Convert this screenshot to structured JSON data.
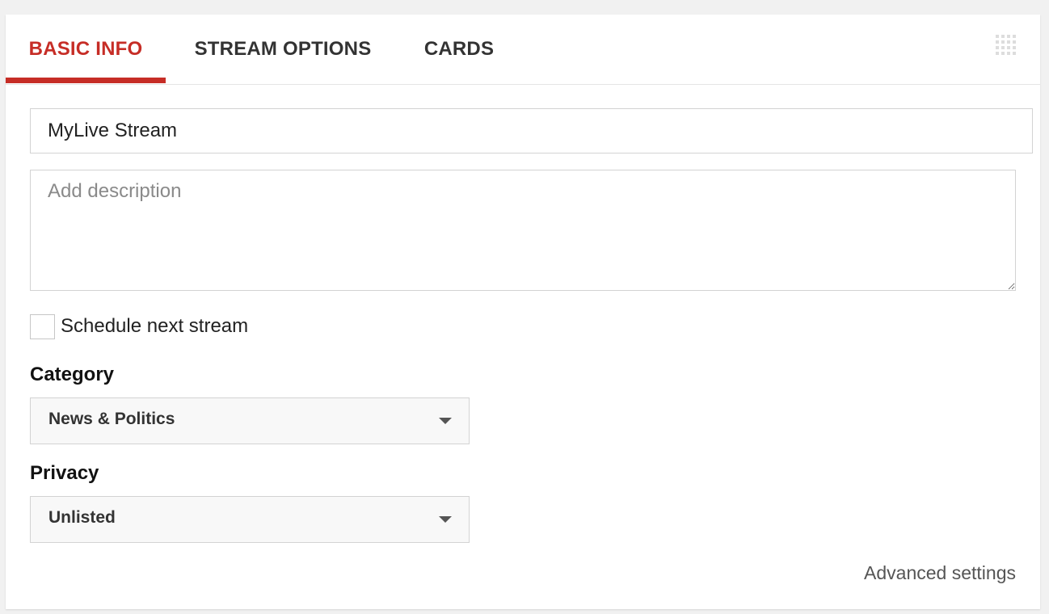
{
  "tabs": [
    {
      "label": "BASIC INFO",
      "active": true
    },
    {
      "label": "STREAM OPTIONS",
      "active": false
    },
    {
      "label": "CARDS",
      "active": false
    }
  ],
  "title_field": {
    "value": "MyLive Stream"
  },
  "description_field": {
    "value": "",
    "placeholder": "Add description"
  },
  "schedule": {
    "label": "Schedule next stream",
    "checked": false
  },
  "category": {
    "label": "Category",
    "selected": "News & Politics"
  },
  "privacy": {
    "label": "Privacy",
    "selected": "Unlisted"
  },
  "advanced_settings": {
    "label": "Advanced settings"
  },
  "colors": {
    "accent": "#c62d26",
    "tab_text": "#333333",
    "border": "#d3d3d3"
  },
  "icons": {
    "drag_handle": "grip-dots-icon",
    "dropdown": "caret-down-icon"
  }
}
